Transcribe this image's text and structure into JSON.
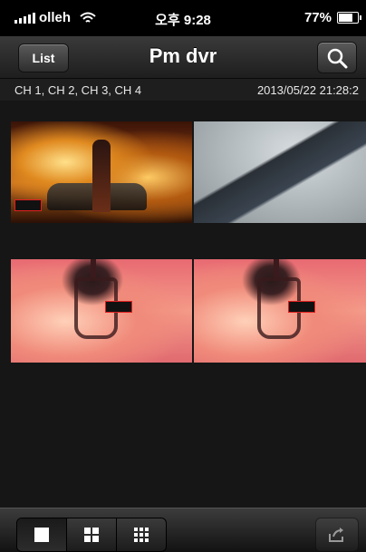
{
  "status_bar": {
    "carrier": "olleh",
    "time": "오후 9:28",
    "battery": "77%",
    "battery_level": 0.77
  },
  "nav": {
    "back_label": "List",
    "title": "Pm dvr",
    "search_icon": "search-icon"
  },
  "info": {
    "channels": "CH 1, CH 2, CH 3, CH 4",
    "timestamp": "2013/05/22 21:28:2"
  },
  "tabs": {
    "icons": [
      "single-view-icon",
      "quad-view-icon",
      "nine-view-icon"
    ],
    "active": 0,
    "share_icon": "share-icon"
  }
}
